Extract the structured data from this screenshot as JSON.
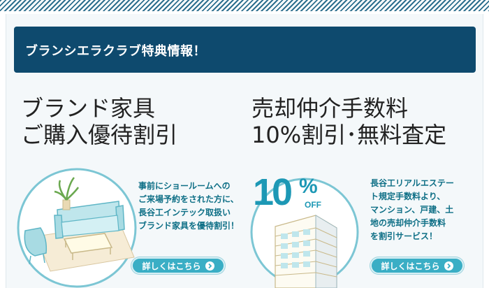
{
  "header": {
    "title": "ブランシエラクラブ特典情報！"
  },
  "offers": [
    {
      "title_line1": "ブランド家具",
      "title_line2": "ご購入優待割引",
      "desc": [
        "事前にショールームへの",
        "ご来場予約をされた方に、",
        "長谷工インテック取扱い",
        "ブランド家具を優待割引！"
      ],
      "button_label": "詳しくはこちら"
    },
    {
      "title_line1": "売却仲介手数料",
      "title_line2": "10%割引･無料査定",
      "desc": [
        "長谷工リアルエステー",
        "ト規定手数料より、",
        "マンション、戸建、土",
        "地の売却仲介手数料",
        "を割引サービス！"
      ],
      "button_label": "詳しくはこちら",
      "badge_value": "10",
      "badge_percent": "%",
      "badge_off": "OFF"
    }
  ],
  "colors": {
    "header_bg": "#0e4a6e",
    "accent": "#3aaec5",
    "desc_text": "#0e6f86"
  },
  "icons": [
    "furniture-illustration",
    "building-illustration",
    "arrow-right-icon"
  ]
}
